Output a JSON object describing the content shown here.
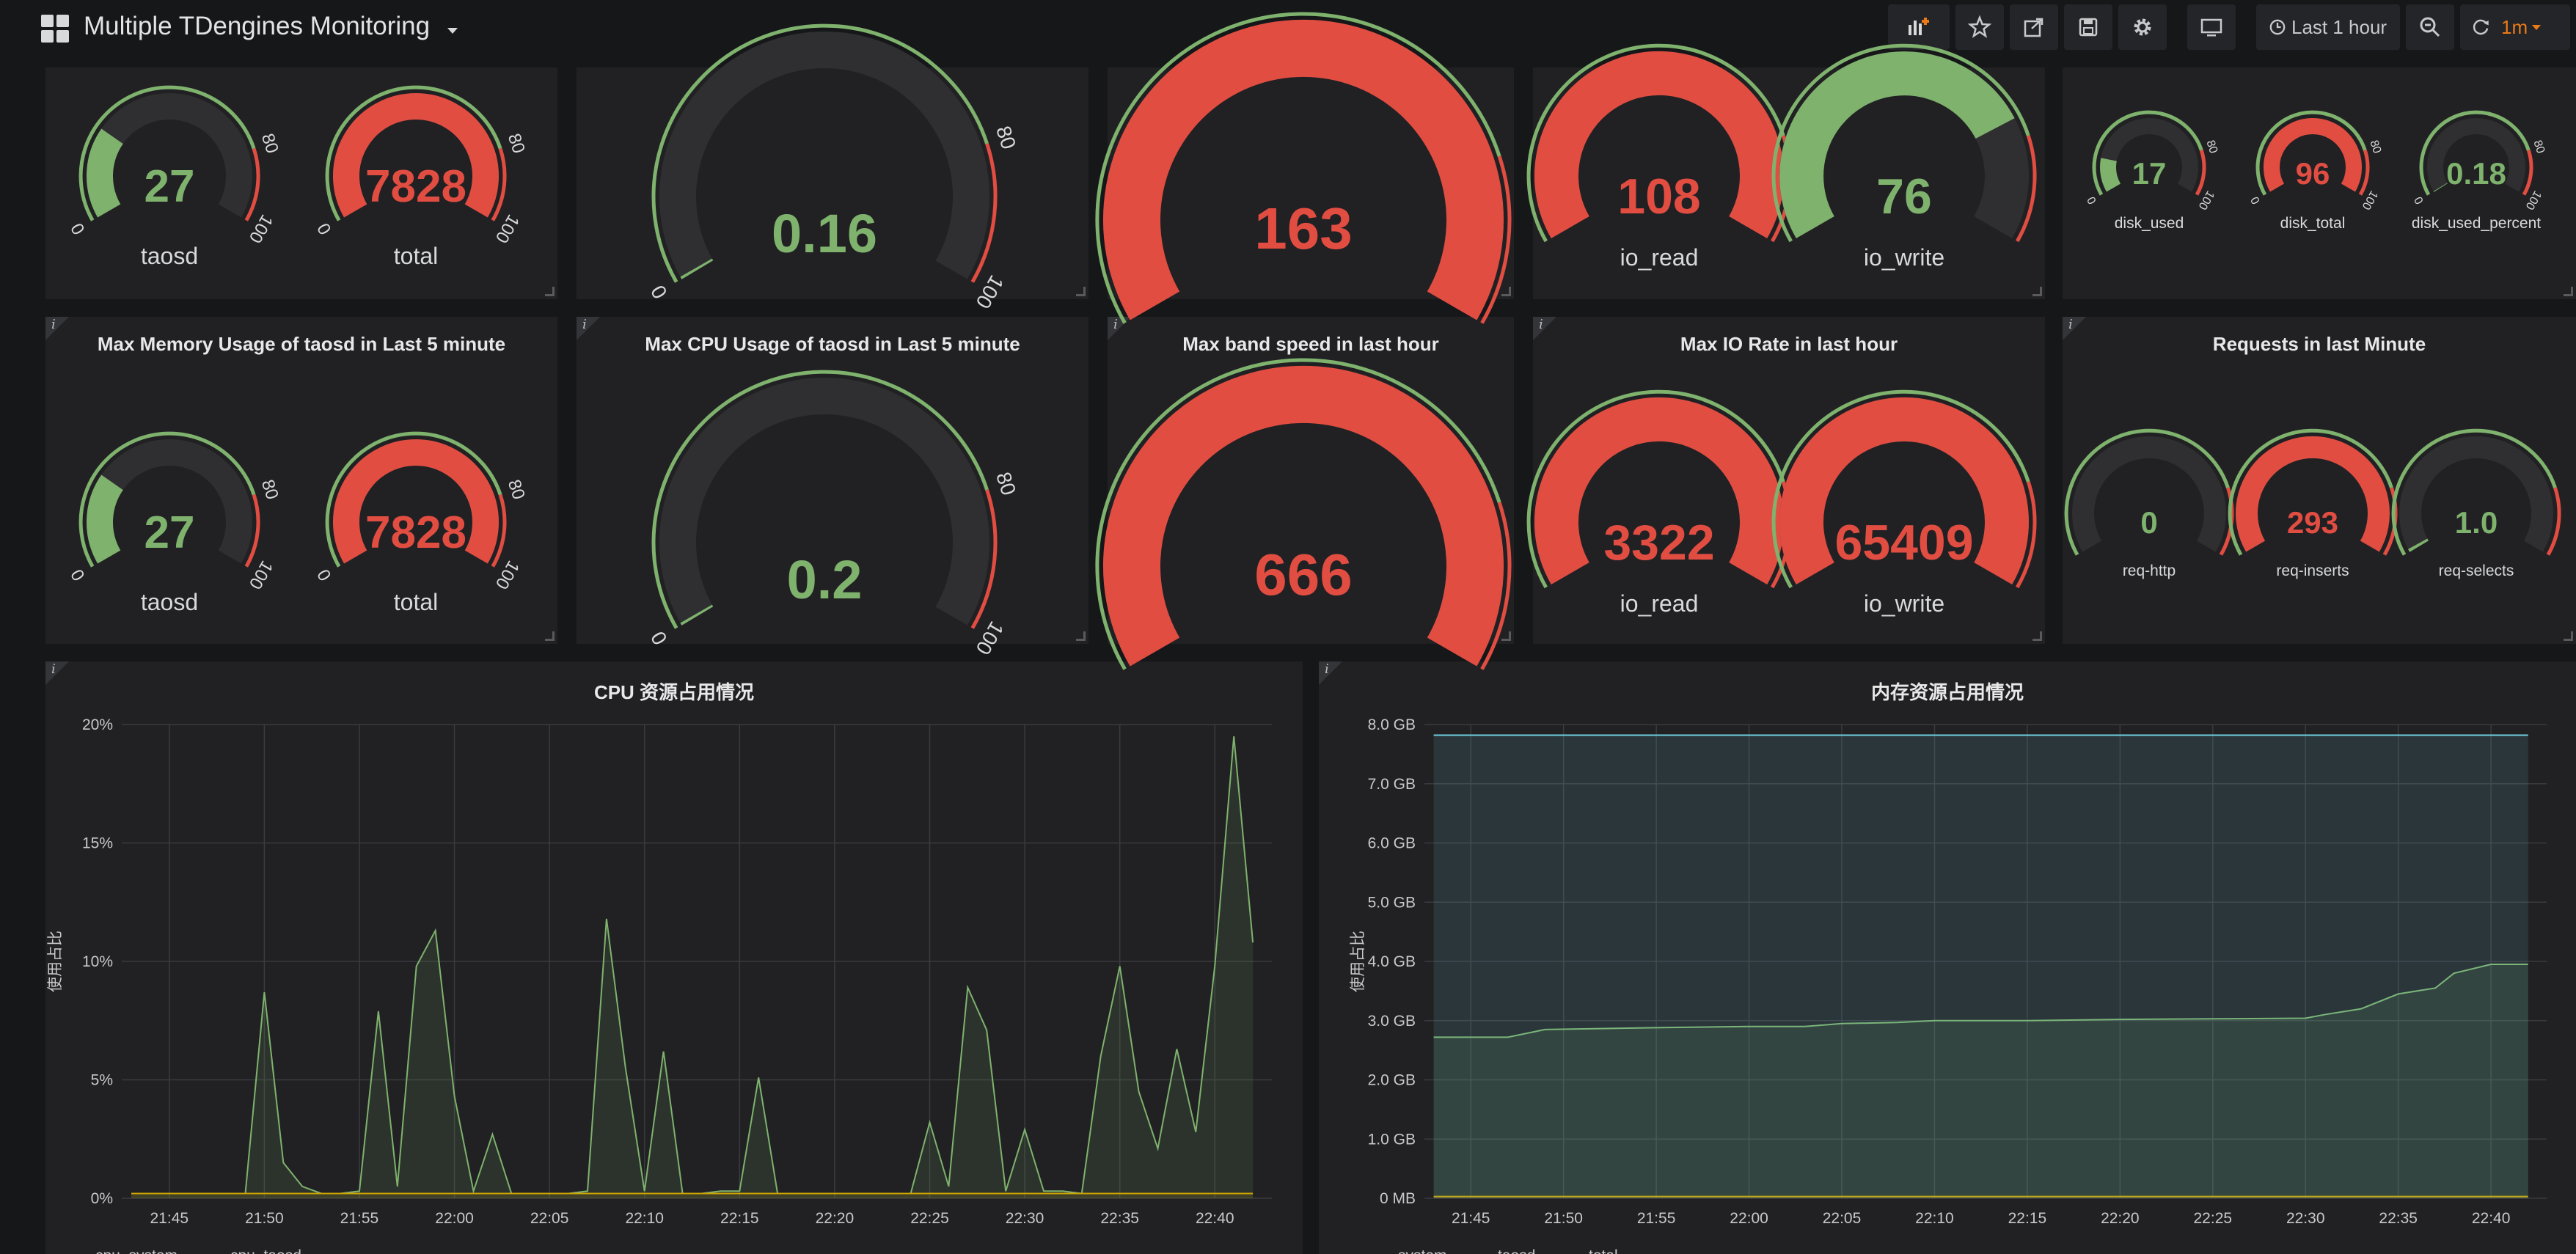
{
  "header": {
    "title": "Multiple TDengines Monitoring",
    "time_range": "Last 1 hour",
    "refresh": "1m",
    "icons": [
      "add-panel-icon",
      "star-icon",
      "share-icon",
      "save-icon",
      "gear-icon",
      "tv-icon",
      "clock-icon",
      "zoom-out-icon",
      "refresh-icon",
      "chevron-down-icon"
    ]
  },
  "row1": {
    "p1": {
      "g1": {
        "value": "27",
        "label": "taosd",
        "min": "0",
        "mid": "80",
        "max": "100"
      },
      "g2": {
        "value": "7828",
        "label": "total",
        "min": "0",
        "mid": "80",
        "max": "100"
      }
    },
    "p2": {
      "g1": {
        "value": "0.16",
        "min": "0",
        "mid": "80",
        "max": "100"
      }
    },
    "p3": {
      "g1": {
        "value": "163"
      }
    },
    "p4": {
      "g1": {
        "value": "108",
        "label": "io_read"
      },
      "g2": {
        "value": "76",
        "label": "io_write"
      }
    },
    "p5": {
      "g1": {
        "value": "17",
        "label": "disk_used",
        "min": "0",
        "mid": "80",
        "max": "100"
      },
      "g2": {
        "value": "96",
        "label": "disk_total",
        "min": "0",
        "mid": "80",
        "max": "100"
      },
      "g3": {
        "value": "0.18",
        "label": "disk_used_percent",
        "min": "0",
        "mid": "80",
        "max": "100"
      }
    }
  },
  "row2": {
    "p1": {
      "title": "Max Memory Usage of taosd in Last 5 minute",
      "g1": {
        "value": "27",
        "label": "taosd",
        "min": "0",
        "mid": "80",
        "max": "100"
      },
      "g2": {
        "value": "7828",
        "label": "total",
        "min": "0",
        "mid": "80",
        "max": "100"
      }
    },
    "p2": {
      "title": "Max CPU Usage of taosd in Last 5 minute",
      "g1": {
        "value": "0.2",
        "min": "0",
        "mid": "80",
        "max": "100"
      }
    },
    "p3": {
      "title": "Max band speed in last hour",
      "g1": {
        "value": "666"
      }
    },
    "p4": {
      "title": "Max IO Rate in last hour",
      "g1": {
        "value": "3322",
        "label": "io_read"
      },
      "g2": {
        "value": "65409",
        "label": "io_write"
      }
    },
    "p5": {
      "title": "Requests in last Minute",
      "g1": {
        "value": "0",
        "label": "req-http"
      },
      "g2": {
        "value": "293",
        "label": "req-inserts"
      },
      "g3": {
        "value": "1.0",
        "label": "req-selects"
      }
    }
  },
  "info_glyph": "i",
  "colors": {
    "green": "#7eb26d",
    "red": "#e24d42",
    "yellow": "#cca300",
    "blue": "#6ed0e0",
    "bg": "#161719",
    "panel": "#212124"
  },
  "chart_data": [
    {
      "type": "area",
      "title": "CPU 资源占用情况",
      "ylabel": "使用占比",
      "yticks": [
        "0%",
        "5%",
        "10%",
        "15%",
        "20%"
      ],
      "ylim": [
        0,
        20
      ],
      "xticks": [
        "21:45",
        "21:50",
        "21:55",
        "22:00",
        "22:05",
        "22:10",
        "22:15",
        "22:20",
        "22:25",
        "22:30",
        "22:35",
        "22:40"
      ],
      "x": [
        "21:43",
        "21:44",
        "21:45",
        "21:46",
        "21:47",
        "21:48",
        "21:49",
        "21:50",
        "21:51",
        "21:52",
        "21:53",
        "21:54",
        "21:55",
        "21:56",
        "21:57",
        "21:58",
        "21:59",
        "22:00",
        "22:01",
        "22:02",
        "22:03",
        "22:04",
        "22:05",
        "22:06",
        "22:07",
        "22:08",
        "22:09",
        "22:10",
        "22:11",
        "22:12",
        "22:13",
        "22:14",
        "22:15",
        "22:16",
        "22:17",
        "22:18",
        "22:19",
        "22:20",
        "22:21",
        "22:22",
        "22:23",
        "22:24",
        "22:25",
        "22:26",
        "22:27",
        "22:28",
        "22:29",
        "22:30",
        "22:31",
        "22:32",
        "22:33",
        "22:34",
        "22:35",
        "22:36",
        "22:37",
        "22:38",
        "22:39",
        "22:40",
        "22:41",
        "22:42"
      ],
      "series": [
        {
          "name": "cpu_system",
          "values": [
            0.2,
            0.2,
            0.2,
            0.2,
            0.2,
            0.2,
            0.2,
            8.7,
            1.5,
            0.5,
            0.2,
            0.2,
            0.3,
            7.9,
            0.5,
            9.8,
            11.3,
            4.3,
            0.3,
            2.7,
            0.2,
            0.2,
            0.2,
            0.2,
            0.3,
            11.8,
            5.5,
            0.3,
            6.2,
            0.2,
            0.2,
            0.3,
            0.3,
            5.1,
            0.2,
            0.2,
            0.2,
            0.2,
            0.2,
            0.2,
            0.2,
            0.2,
            3.2,
            0.5,
            8.9,
            7.1,
            0.3,
            2.9,
            0.3,
            0.3,
            0.2,
            6.0,
            9.8,
            4.5,
            2.1,
            6.3,
            2.8,
            9.8,
            19.5,
            10.8
          ]
        },
        {
          "name": "cpu_taosd",
          "values": [
            0.2,
            0.2,
            0.2,
            0.2,
            0.2,
            0.2,
            0.2,
            0.2,
            0.2,
            0.2,
            0.2,
            0.2,
            0.2,
            0.2,
            0.2,
            0.2,
            0.2,
            0.2,
            0.2,
            0.2,
            0.2,
            0.2,
            0.2,
            0.2,
            0.2,
            0.2,
            0.2,
            0.2,
            0.2,
            0.2,
            0.2,
            0.2,
            0.2,
            0.2,
            0.2,
            0.2,
            0.2,
            0.2,
            0.2,
            0.2,
            0.2,
            0.2,
            0.2,
            0.2,
            0.2,
            0.2,
            0.2,
            0.2,
            0.2,
            0.2,
            0.2,
            0.2,
            0.2,
            0.2,
            0.2,
            0.2,
            0.2,
            0.2,
            0.2,
            0.2
          ]
        }
      ],
      "legend": [
        "cpu_system",
        "cpu_taosd"
      ]
    },
    {
      "type": "area",
      "title": "内存资源占用情况",
      "ylabel": "使用占比",
      "yticks": [
        "0 MB",
        "1.0 GB",
        "2.0 GB",
        "3.0 GB",
        "4.0 GB",
        "5.0 GB",
        "6.0 GB",
        "7.0 GB",
        "8.0 GB"
      ],
      "ylim": [
        0,
        8
      ],
      "xticks": [
        "21:45",
        "21:50",
        "21:55",
        "22:00",
        "22:05",
        "22:10",
        "22:15",
        "22:20",
        "22:25",
        "22:30",
        "22:35",
        "22:40"
      ],
      "x": [
        "21:43",
        "21:47",
        "21:49",
        "21:55",
        "22:00",
        "22:03",
        "22:05",
        "22:08",
        "22:10",
        "22:15",
        "22:20",
        "22:25",
        "22:30",
        "22:31",
        "22:33",
        "22:35",
        "22:37",
        "22:38",
        "22:40",
        "22:42"
      ],
      "series": [
        {
          "name": "system",
          "values": [
            2.72,
            2.72,
            2.85,
            2.88,
            2.9,
            2.9,
            2.95,
            2.97,
            3.0,
            3.0,
            3.02,
            3.03,
            3.04,
            3.1,
            3.2,
            3.45,
            3.55,
            3.8,
            3.95,
            3.95
          ]
        },
        {
          "name": "taosd",
          "values": [
            0.03,
            0.03,
            0.03,
            0.03,
            0.03,
            0.03,
            0.03,
            0.03,
            0.03,
            0.03,
            0.03,
            0.03,
            0.03,
            0.03,
            0.03,
            0.03,
            0.03,
            0.03,
            0.03,
            0.03
          ]
        },
        {
          "name": "total",
          "values": [
            7.82,
            7.82,
            7.82,
            7.82,
            7.82,
            7.82,
            7.82,
            7.82,
            7.82,
            7.82,
            7.82,
            7.82,
            7.82,
            7.82,
            7.82,
            7.82,
            7.82,
            7.82,
            7.82,
            7.82
          ]
        }
      ],
      "legend": [
        "system",
        "taosd",
        "total"
      ]
    }
  ]
}
